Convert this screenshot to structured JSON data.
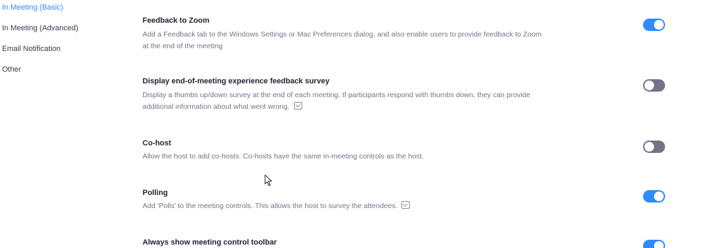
{
  "nav": {
    "items": [
      {
        "label": "In Meeting (Basic)",
        "active": true
      },
      {
        "label": "In Meeting (Advanced)",
        "active": false
      },
      {
        "label": "Email Notification",
        "active": false
      },
      {
        "label": "Other",
        "active": false
      }
    ]
  },
  "settings": [
    {
      "title": "Feedback to Zoom",
      "description": "Add a Feedback tab to the Windows Settings or Mac Preferences dialog, and also enable users to provide feedback to Zoom at the end of the meeting",
      "enabled": true,
      "info_icon": false
    },
    {
      "title": "Display end-of-meeting experience feedback survey",
      "description": "Display a thumbs up/down survey at the end of each meeting. If participants respond with thumbs down, they can provide additional information about what went wrong.",
      "enabled": false,
      "info_icon": true
    },
    {
      "title": "Co-host",
      "description": "Allow the host to add co-hosts. Co-hosts have the same in-meeting controls as the host.",
      "enabled": false,
      "info_icon": false
    },
    {
      "title": "Polling",
      "description": "Add 'Polls' to the meeting controls. This allows the host to survey the attendees.",
      "enabled": true,
      "info_icon": true
    },
    {
      "title": "Always show meeting control toolbar",
      "description": "",
      "enabled": true,
      "info_icon": false
    }
  ],
  "colors": {
    "accent": "#2d8cff",
    "toggle_off": "#747487",
    "title_text": "#232333",
    "desc_text": "#747487"
  },
  "icons": {
    "info": "info-icon",
    "pointer": "mouse-pointer-icon"
  }
}
